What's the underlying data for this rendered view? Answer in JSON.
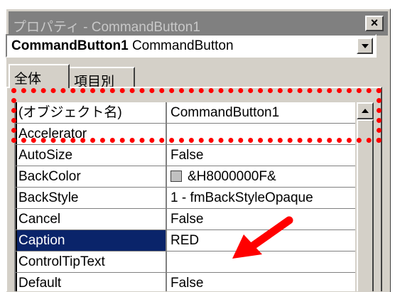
{
  "window": {
    "title": "プロパティ - CommandButton1",
    "close_label": "×"
  },
  "object_selector": {
    "name": "CommandButton1",
    "type": "CommandButton"
  },
  "tabs": [
    {
      "label": "全体"
    },
    {
      "label": "項目別"
    }
  ],
  "properties": [
    {
      "name": "(オブジェクト名)",
      "value": "CommandButton1"
    },
    {
      "name": "Accelerator",
      "value": ""
    },
    {
      "name": "AutoSize",
      "value": "False"
    },
    {
      "name": "BackColor",
      "value": "&H8000000F&",
      "swatch_color": "#c0c0c0"
    },
    {
      "name": "BackStyle",
      "value": "1 - fmBackStyleOpaque"
    },
    {
      "name": "Cancel",
      "value": "False"
    },
    {
      "name": "Caption",
      "value": "RED",
      "selected": true
    },
    {
      "name": "ControlTipText",
      "value": ""
    },
    {
      "name": "Default",
      "value": "False"
    }
  ],
  "colors": {
    "selection": "#0a246a",
    "annotation": "#ff0000",
    "face": "#d4d0c8"
  }
}
